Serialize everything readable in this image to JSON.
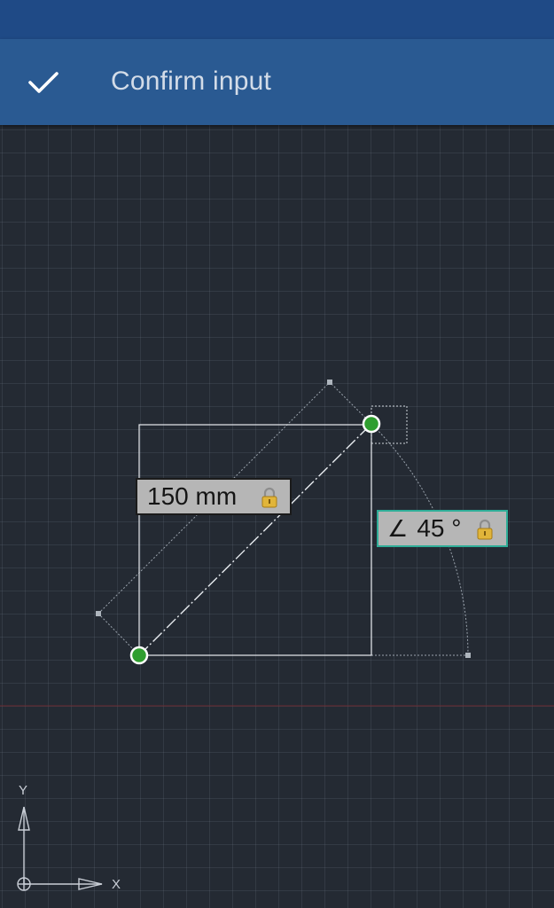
{
  "actionbar": {
    "confirm_icon": "checkmark-icon",
    "title": "Confirm input"
  },
  "dimensions": {
    "length_value": "150 mm",
    "length_lock_icon": "lock-icon",
    "angle_symbol": "∠",
    "angle_value": "45 °",
    "angle_lock_icon": "lock-icon"
  },
  "ucs": {
    "y_label": "Y",
    "x_label": "X"
  },
  "colors": {
    "statusbar": "#1f4a86",
    "actionbar": "#2a5a92",
    "canvas": "#242a33",
    "snap_point": "#2f9e2f",
    "angle_tag_border": "#2fae98",
    "lock": "#e1b53a"
  }
}
